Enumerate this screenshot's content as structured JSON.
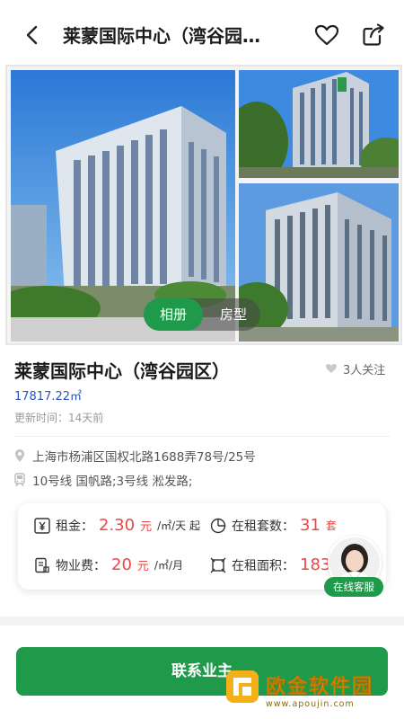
{
  "header": {
    "title": "莱蒙国际中心（湾谷园…",
    "back_icon": "chevron-left-icon",
    "favorite_icon": "heart-outline-icon",
    "share_icon": "share-icon"
  },
  "gallery": {
    "tabs": [
      {
        "label": "相册",
        "active": true
      },
      {
        "label": "房型",
        "active": false
      }
    ]
  },
  "property": {
    "name": "莱蒙国际中心（湾谷园区）",
    "follow_count": "3人关注",
    "area": "17817.22㎡",
    "updated": "更新时间：14天前",
    "address": "上海市杨浦区国权北路1688弄78号/25号",
    "subway": "10号线 国帆路;3号线 淞发路;"
  },
  "stats": {
    "rent_label": "租金：",
    "rent_value": "2.30",
    "rent_unit_yuan": "元",
    "rent_unit": "/㎡/天 起",
    "count_label": "在租套数：",
    "count_value": "31",
    "count_unit": "套",
    "fee_label": "物业费：",
    "fee_value": "20",
    "fee_unit_yuan": "元",
    "fee_unit": "/㎡/月",
    "area_label": "在租面积：",
    "area_value": "1835"
  },
  "customer_service": {
    "label": "在线客服"
  },
  "contact": {
    "label": "联系业主"
  },
  "watermark": {
    "text": "欧金软件园",
    "url": "www.apoujin.com"
  },
  "colors": {
    "brand_green": "#1f9a4a",
    "price_red": "#e84848",
    "link_blue": "#2a55b8"
  }
}
